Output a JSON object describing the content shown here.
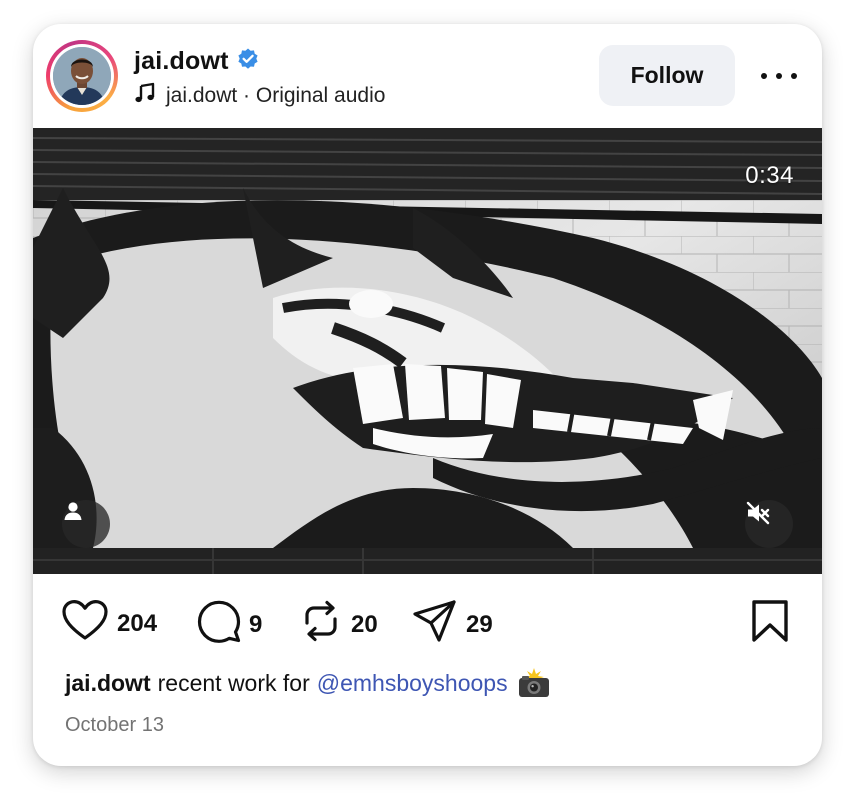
{
  "post": {
    "username": "jai.dowt",
    "verified": true,
    "audio_label": "jai.dowt · Original audio",
    "follow_label": "Follow",
    "video_duration": "0:34",
    "muted": true,
    "likes": "204",
    "comments": "9",
    "reposts": "20",
    "shares": "29",
    "caption_user": "jai.dowt",
    "caption_text": "recent work for",
    "caption_mention": "@emhsboyshoops",
    "caption_emoji": "📸",
    "date": "October 13"
  },
  "icons": {
    "verified": "verified-badge-icon",
    "audio": "music-note-icon",
    "more": "more-options-icon",
    "tag": "tagged-people-icon",
    "mute": "speaker-muted-icon",
    "like": "heart-icon",
    "comment": "comment-bubble-icon",
    "repost": "repost-icon",
    "share": "send-icon",
    "save": "bookmark-icon"
  },
  "colors": {
    "verified": "#3a8ee6",
    "mention": "#3e56b3",
    "follow_bg": "#eff1f5",
    "date": "#737373"
  }
}
